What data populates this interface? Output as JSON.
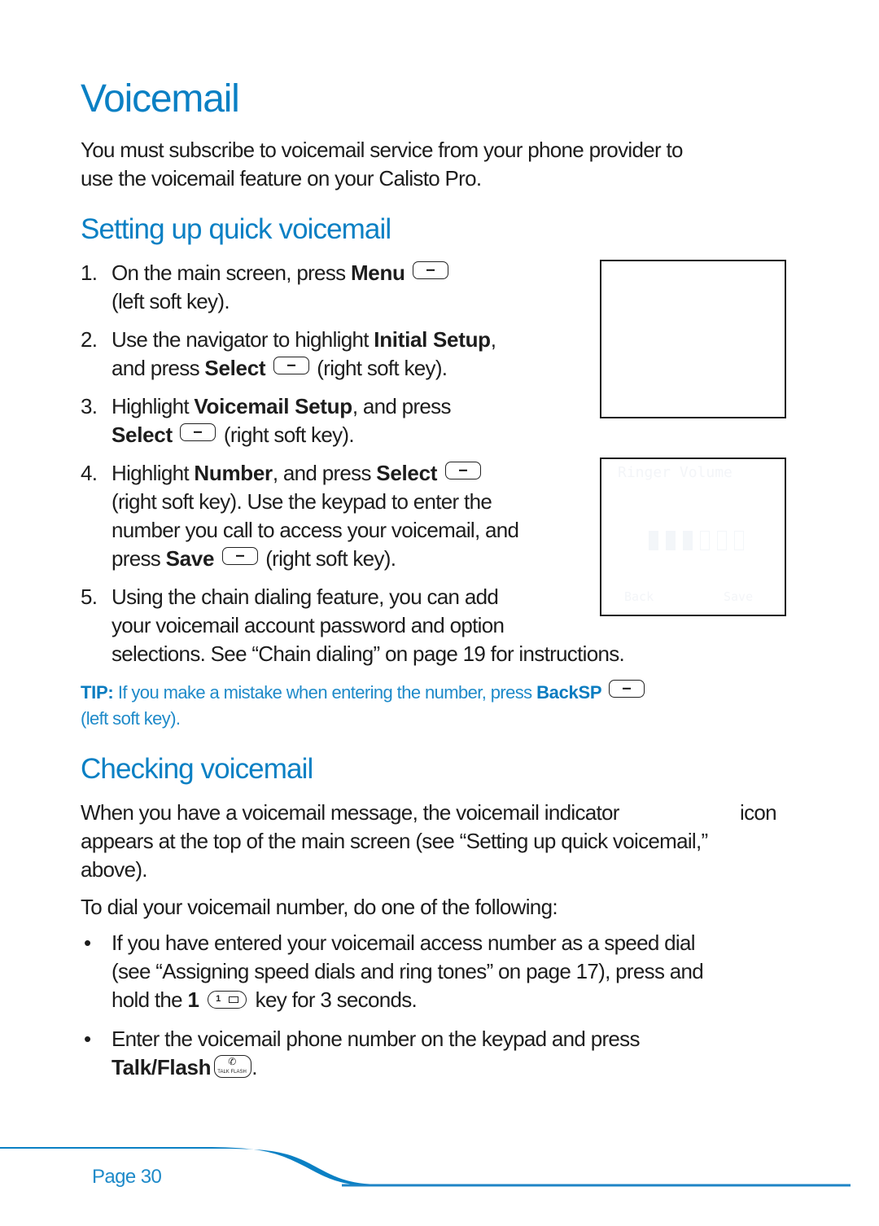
{
  "title": "Voicemail",
  "intro": {
    "line1": "You must subscribe to voicemail service from your phone provider to",
    "line2": "use the voicemail feature on your Calisto Pro."
  },
  "section1": {
    "heading": "Setting up quick voicemail",
    "steps": [
      {
        "num": "1.",
        "l1_pre": "On the main screen, press ",
        "l1_bold": "Menu",
        "l1_key": "soft-key-icon",
        "l2": "(left soft key)."
      },
      {
        "num": "2.",
        "l1_pre": "Use the navigator to highlight ",
        "l1_bold": "Initial Setup",
        "l1_post": ",",
        "l2_pre": "and press ",
        "l2_bold": "Select",
        "l2_post": " (right soft key)."
      },
      {
        "num": "3.",
        "l1_pre": "Highlight ",
        "l1_bold": "Voicemail Setup",
        "l1_post": ", and press",
        "l2_bold": "Select",
        "l2_post": " (right soft key)."
      },
      {
        "num": "4.",
        "l1_pre": "Highlight ",
        "l1_bold": "Number",
        "l1_mid": ", and press ",
        "l1_bold2": "Select",
        "l2": "(right soft key). Use the keypad to enter the",
        "l3": "number you call to access your voicemail, and",
        "l4_pre": "press ",
        "l4_bold": "Save",
        "l4_post": " (right soft key)."
      },
      {
        "num": "5.",
        "l1": "Using the chain dialing feature, you can add",
        "l2": "your voicemail account password and option",
        "l3": "selections. See “Chain dialing” on page 19 for instructions."
      }
    ],
    "screens": [
      {
        "name": "phone-screen-main",
        "content": ""
      },
      {
        "name": "phone-screen-ringer",
        "title": "Ringer Volume",
        "level_filled": 3,
        "level_total": 6,
        "left_key": "Back",
        "right_key": "Save"
      }
    ]
  },
  "tip": {
    "label": "TIP:",
    "l1_pre": " If you make a mistake when entering the number, press ",
    "l1_bold": "BackSP",
    "l2": "(left soft key)."
  },
  "section2": {
    "heading": "Checking voicemail",
    "p1": {
      "l1_pre": "When you have a voicemail message, the voicemail indicator",
      "l1_post": "icon",
      "l2": "appears at the top of the main screen (see “Setting up quick voicemail,”",
      "l3": "above)."
    },
    "p2": "To dial your voicemail number, do one of the following:",
    "bullets": [
      {
        "l1": "If you have entered your voicemail access number as a speed dial",
        "l2": "(see “Assigning speed dials and ring tones” on page 17), press and",
        "l3_pre": "hold the ",
        "l3_bold": "1",
        "l3_key": "1",
        "l3_post": " key for 3 seconds."
      },
      {
        "l1": "Enter the voicemail phone number on the keypad and press",
        "l2_bold": "Talk/Flash",
        "l2_key_label": "TALK FLASH",
        "l2_post": "."
      }
    ],
    "bullet_char": "•"
  },
  "footer": {
    "page_label": "Page 30",
    "accent_color": "#0a80c4"
  }
}
